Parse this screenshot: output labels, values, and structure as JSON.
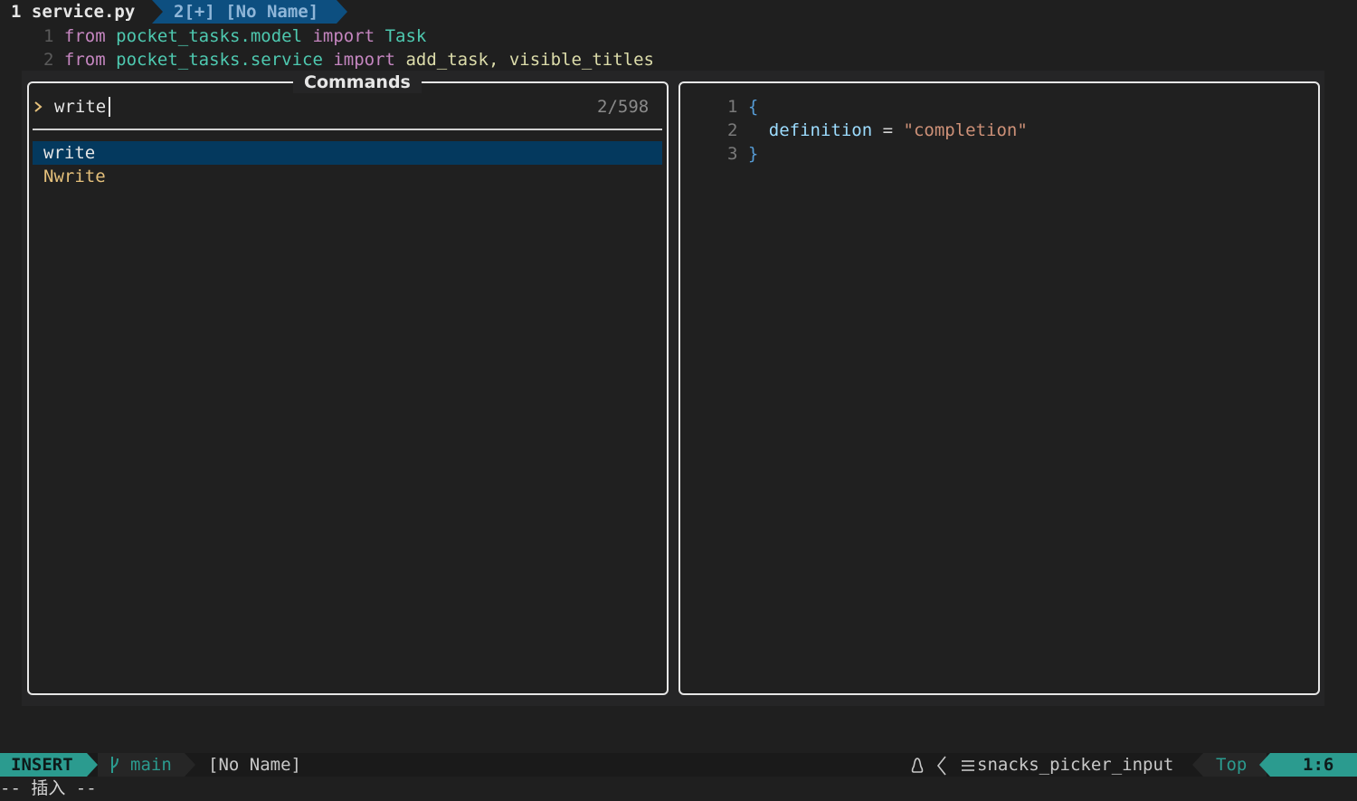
{
  "tabline": {
    "active": "1 service.py",
    "inactive": "2[+] [No Name]"
  },
  "editor": {
    "lines": [
      {
        "num": "1",
        "kw1": "from",
        "mod": "pocket_tasks.model",
        "kw2": "import",
        "sym": "Task"
      },
      {
        "num": "2",
        "kw1": "from",
        "mod": "pocket_tasks.service",
        "kw2": "import",
        "sym": "add_task, visible_titles"
      }
    ]
  },
  "picker": {
    "title": "Commands",
    "prompt_icon": ">",
    "query": "write",
    "count": "2/598",
    "items": [
      "write",
      "Nwrite"
    ]
  },
  "preview": {
    "lines": [
      {
        "num": "1",
        "text": "{"
      },
      {
        "num": "2",
        "prop": "definition",
        "eq": " = ",
        "str": "\"completion\""
      },
      {
        "num": "3",
        "text": "}"
      }
    ]
  },
  "statusline": {
    "mode": "INSERT",
    "branch_icon": "git-branch-icon",
    "branch": "main",
    "filename": "[No Name]",
    "os_icon": "linux-icon",
    "filetype_icon": "lines-icon",
    "filetype": "snacks_picker_input",
    "scroll": "Top",
    "position": "1:6"
  },
  "cmdline": "-- 插入 --",
  "colors": {
    "accent": "#2b9b8f",
    "selection": "#04395e",
    "tab_inactive": "#0d4f80"
  }
}
